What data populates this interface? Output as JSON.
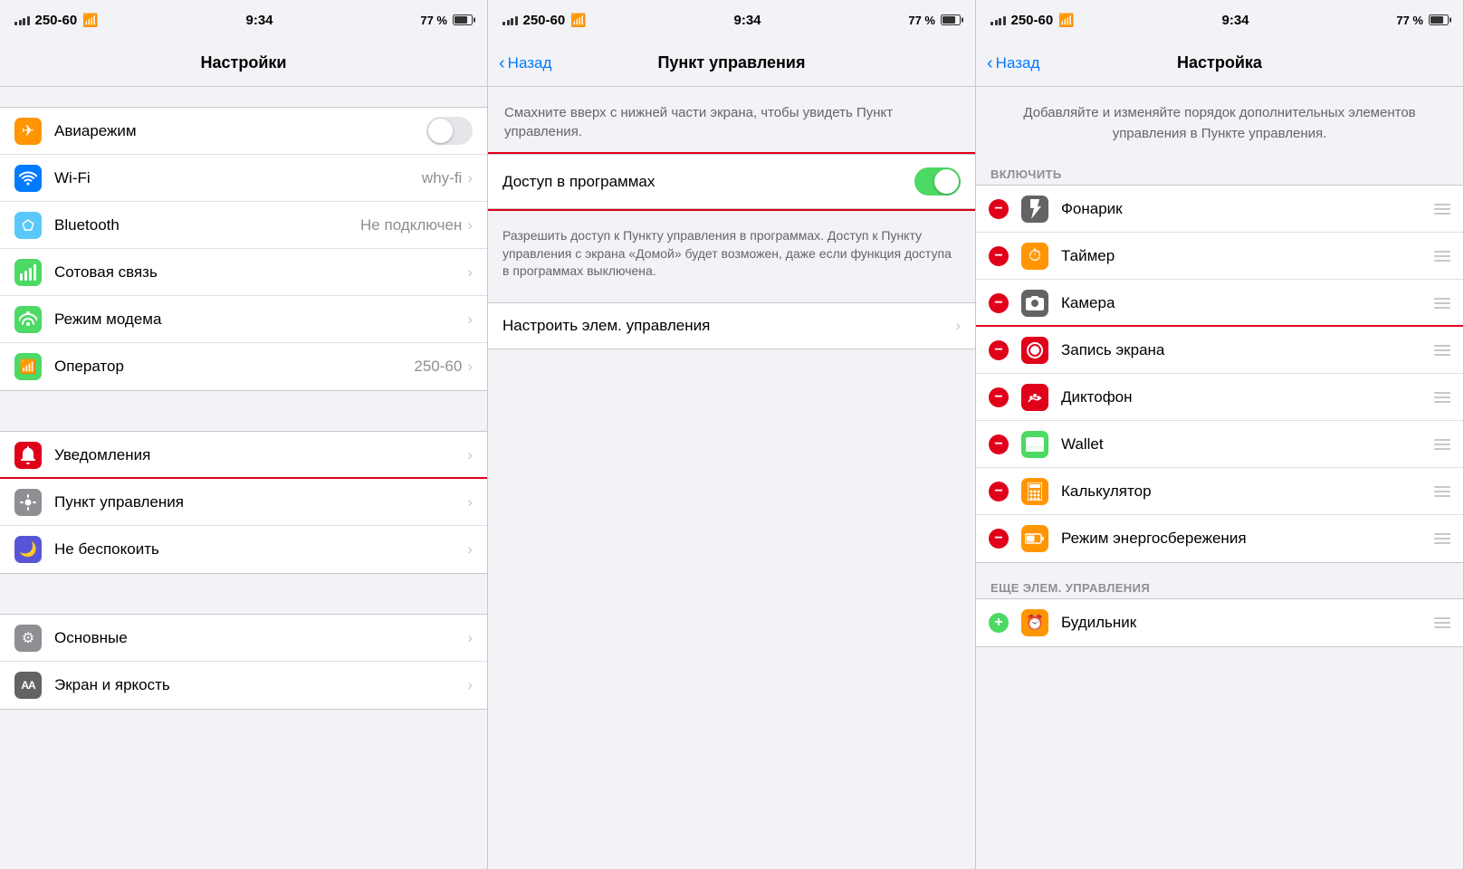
{
  "panels": [
    {
      "id": "settings",
      "statusBar": {
        "carrier": "250-60",
        "time": "9:34",
        "battery": "77 %"
      },
      "navTitle": "Настройки",
      "sections": [
        {
          "cells": [
            {
              "id": "airplane",
              "icon": "✈",
              "iconBg": "bg-orange",
              "label": "Авиарежим",
              "type": "toggle",
              "toggleOn": false,
              "value": "",
              "chevron": false
            },
            {
              "id": "wifi",
              "icon": "wifi",
              "iconBg": "bg-blue",
              "label": "Wi-Fi",
              "type": "value",
              "value": "why-fi",
              "chevron": true
            },
            {
              "id": "bluetooth",
              "icon": "bluetooth",
              "iconBg": "bg-blue-light",
              "label": "Bluetooth",
              "type": "value",
              "value": "Не подключен",
              "chevron": true
            },
            {
              "id": "cellular",
              "icon": "cellular",
              "iconBg": "bg-green",
              "label": "Сотовая связь",
              "type": "chevron",
              "value": "",
              "chevron": true
            },
            {
              "id": "hotspot",
              "icon": "hotspot",
              "iconBg": "bg-green",
              "label": "Режим модема",
              "type": "chevron",
              "value": "",
              "chevron": true
            },
            {
              "id": "operator",
              "icon": "phone",
              "iconBg": "bg-phone-green",
              "label": "Оператор",
              "type": "value",
              "value": "250-60",
              "chevron": true
            }
          ]
        },
        {
          "cells": [
            {
              "id": "notifications",
              "icon": "notif",
              "iconBg": "bg-red",
              "label": "Уведомления",
              "type": "chevron",
              "value": "",
              "chevron": true
            },
            {
              "id": "control-center",
              "icon": "cc",
              "iconBg": "bg-gray",
              "label": "Пункт управления",
              "type": "chevron",
              "value": "",
              "chevron": true,
              "highlighted": true
            },
            {
              "id": "dnd",
              "icon": "moon",
              "iconBg": "bg-indigo",
              "label": "Не беспокоить",
              "type": "chevron",
              "value": "",
              "chevron": true
            }
          ]
        },
        {
          "cells": [
            {
              "id": "general",
              "icon": "gear",
              "iconBg": "bg-gray",
              "label": "Основные",
              "type": "chevron",
              "value": "",
              "chevron": true
            },
            {
              "id": "display",
              "icon": "AA",
              "iconBg": "bg-dark-gray",
              "label": "Экран и яркость",
              "type": "chevron",
              "value": "",
              "chevron": true
            }
          ]
        }
      ]
    },
    {
      "id": "control-center",
      "statusBar": {
        "carrier": "250-60",
        "time": "9:34",
        "battery": "77 %"
      },
      "navTitle": "Пункт управления",
      "backLabel": "Назад",
      "description": "Смахните вверх с нижней части экрана, чтобы увидеть Пункт управления.",
      "accessRowLabel": "Доступ в программах",
      "accessToggleOn": true,
      "accessDesc": "Разрешить доступ к Пункту управления в программах. Доступ к Пункту управления с экрана «Домой» будет возможен, даже если функция доступа в программах выключена.",
      "configureLabel": "Настроить элем. управления"
    },
    {
      "id": "customize",
      "statusBar": {
        "carrier": "250-60",
        "time": "9:34",
        "battery": "77 %"
      },
      "navTitle": "Настройка",
      "backLabel": "Назад",
      "headerText": "Добавляйте и изменяйте порядок дополнительных элементов управления в Пункте управления.",
      "includeSectionLabel": "ВКЛЮЧИТЬ",
      "includeItems": [
        {
          "id": "flashlight",
          "icon": "flashlight",
          "iconBg": "bg-dark-gray",
          "label": "Фонарик"
        },
        {
          "id": "timer",
          "icon": "timer",
          "iconBg": "bg-orange",
          "label": "Таймер"
        },
        {
          "id": "camera",
          "icon": "camera",
          "iconBg": "bg-dark-gray",
          "label": "Камера",
          "highlighted": false
        },
        {
          "id": "screen-record",
          "icon": "record",
          "iconBg": "bg-red",
          "label": "Запись экрана",
          "highlighted": true
        },
        {
          "id": "voice-memos",
          "icon": "mic",
          "iconBg": "bg-red",
          "label": "Диктофон"
        },
        {
          "id": "wallet",
          "icon": "wallet",
          "iconBg": "bg-green",
          "label": "Wallet"
        },
        {
          "id": "calculator",
          "icon": "calc",
          "iconBg": "bg-orange",
          "label": "Калькулятор"
        },
        {
          "id": "low-power",
          "icon": "battery",
          "iconBg": "bg-orange",
          "label": "Режим энергосбережения"
        }
      ],
      "moreSectionLabel": "ЕЩЕ ЭЛЕМ. УПРАВЛЕНИЯ",
      "moreItems": [
        {
          "id": "alarm",
          "icon": "alarm",
          "iconBg": "bg-orange",
          "label": "Будильник"
        }
      ]
    }
  ]
}
